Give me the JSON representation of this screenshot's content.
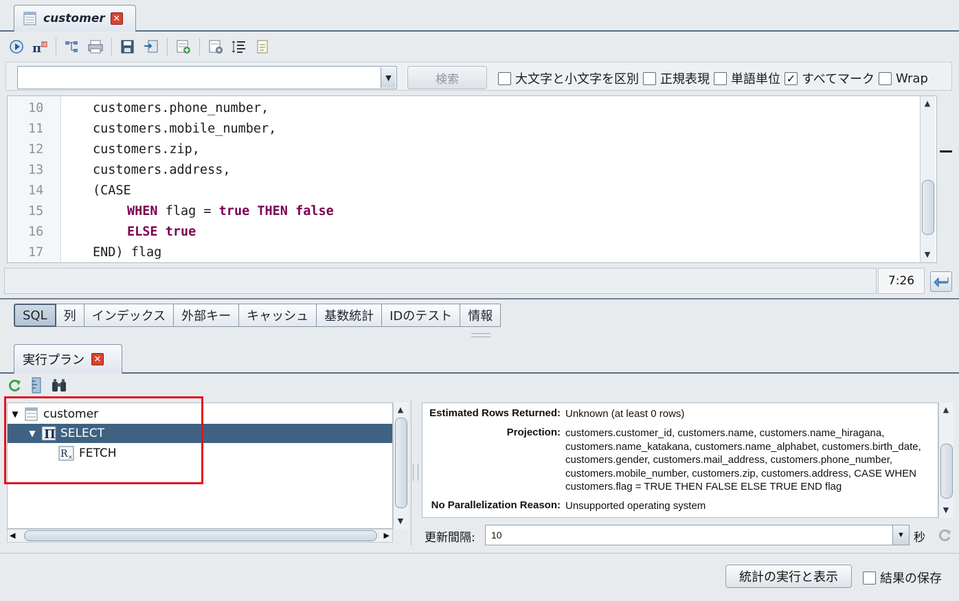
{
  "document_tab": {
    "title": "customer",
    "close_icon": "close-icon"
  },
  "toolbar": {
    "buttons": [
      "run-icon",
      "explain-icon",
      "tree-icon",
      "print-icon",
      "save-icon",
      "export-icon",
      "add-row-icon",
      "settings-icon",
      "format-icon",
      "notes-icon"
    ]
  },
  "search": {
    "value": "",
    "button_label": "検索",
    "case_sensitive": {
      "label": "大文字と小文字を区別",
      "checked": false
    },
    "regex": {
      "label": "正規表現",
      "checked": false
    },
    "whole_word": {
      "label": "単語単位",
      "checked": false
    },
    "mark_all": {
      "label": "すべてマーク",
      "checked": true
    },
    "wrap": {
      "label": "Wrap",
      "checked": false
    }
  },
  "editor": {
    "lines": [
      {
        "n": "10",
        "indent": 0,
        "tokens": [
          {
            "t": "customers.phone_number,",
            "kw": false
          }
        ]
      },
      {
        "n": "11",
        "indent": 0,
        "tokens": [
          {
            "t": "customers.mobile_number,",
            "kw": false
          }
        ]
      },
      {
        "n": "12",
        "indent": 0,
        "tokens": [
          {
            "t": "customers.zip,",
            "kw": false
          }
        ]
      },
      {
        "n": "13",
        "indent": 0,
        "tokens": [
          {
            "t": "customers.address,",
            "kw": false
          }
        ]
      },
      {
        "n": "14",
        "indent": 0,
        "tokens": [
          {
            "t": "(CASE",
            "kw": false
          }
        ]
      },
      {
        "n": "15",
        "indent": 1,
        "tokens": [
          {
            "t": "WHEN",
            "kw": true
          },
          {
            "t": " flag = ",
            "kw": false
          },
          {
            "t": "true",
            "kw": true
          },
          {
            "t": " ",
            "kw": false
          },
          {
            "t": "THEN",
            "kw": true
          },
          {
            "t": " ",
            "kw": false
          },
          {
            "t": "false",
            "kw": true
          }
        ]
      },
      {
        "n": "16",
        "indent": 1,
        "tokens": [
          {
            "t": "ELSE",
            "kw": true
          },
          {
            "t": " ",
            "kw": false
          },
          {
            "t": "true",
            "kw": true
          }
        ]
      },
      {
        "n": "17",
        "indent": 0,
        "tokens": [
          {
            "t": "END) flag",
            "kw": false
          }
        ]
      }
    ]
  },
  "status": {
    "message": "",
    "cursor_position": "7:26"
  },
  "tabs": [
    {
      "label": "SQL",
      "active": true
    },
    {
      "label": "列",
      "active": false
    },
    {
      "label": "インデックス",
      "active": false
    },
    {
      "label": "外部キー",
      "active": false
    },
    {
      "label": "キャッシュ",
      "active": false
    },
    {
      "label": "基数統計",
      "active": false
    },
    {
      "label": "IDのテスト",
      "active": false
    },
    {
      "label": "情報",
      "active": false
    }
  ],
  "plan": {
    "tab_label": "実行プラン",
    "tree": [
      {
        "label": "customer",
        "level": 0,
        "icon": "table-icon",
        "expanded": true,
        "selected": false
      },
      {
        "label": "SELECT",
        "level": 1,
        "icon": "projection-icon",
        "expanded": true,
        "selected": true
      },
      {
        "label": "FETCH",
        "level": 2,
        "icon": "fetch-icon",
        "expanded": null,
        "selected": false
      }
    ],
    "details": [
      {
        "key": "Estimated Rows Returned:",
        "value": "Unknown (at least 0 rows)"
      },
      {
        "key": "Projection:",
        "value": "customers.customer_id, customers.name, customers.name_hiragana, customers.name_katakana, customers.name_alphabet, customers.birth_date, customers.gender, customers.mail_address, customers.phone_number, customers.mobile_number, customers.zip, customers.address, CASE WHEN customers.flag = TRUE THEN FALSE ELSE TRUE END flag"
      },
      {
        "key": "No Parallelization Reason:",
        "value": "Unsupported operating system"
      }
    ],
    "refresh": {
      "label": "更新間隔:",
      "value": "10",
      "unit": "秒"
    }
  },
  "footer": {
    "run_button": "統計の実行と表示",
    "save_results": {
      "label": "結果の保存",
      "checked": false
    }
  },
  "colors": {
    "keyword": "#7b0052",
    "selection": "#3f6283",
    "highlight_box": "#e2141c"
  }
}
